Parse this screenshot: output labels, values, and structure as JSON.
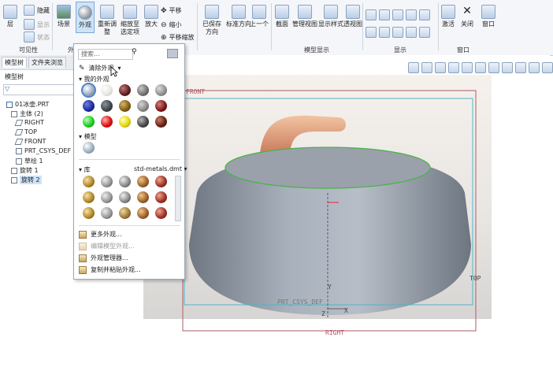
{
  "ribbon": {
    "hide": "隐藏",
    "show": "显示",
    "status": "状态",
    "layer": "层",
    "visibility_group": "可见性",
    "scene": "场景",
    "appearance": "外观",
    "appearance_group": "外观",
    "regenerate": "重新调整",
    "zoom_to_selected": "缩放至选定项",
    "zoom_in": "放大",
    "pan": "平移",
    "zoom_out": "缩小",
    "pan_zoom": "平移缩放",
    "saved_orientations": "已保存方向",
    "standard_orientation": "标准方向",
    "previous": "上一个",
    "section": "截面",
    "manage_views": "管理视图",
    "display_style": "显示样式",
    "perspective": "透视图",
    "model_display_group": "模型显示",
    "show_group": "显示",
    "activate": "激活",
    "close": "关闭",
    "window": "窗口",
    "window_group": "窗口"
  },
  "left_panel": {
    "tab_model_tree": "模型树",
    "tab_file_browser": "文件夹浏览",
    "tree_title": "模型树",
    "items": [
      "01冰壶.PRT",
      "主体 (2)",
      "RIGHT",
      "TOP",
      "FRONT",
      "PRT_CSYS_DEF",
      "草绘 1",
      "旋转 1",
      "旋转 2"
    ]
  },
  "popup": {
    "search_placeholder": "搜索...",
    "clear_appearance": "清除外观",
    "my_appearances": "我的外观",
    "model": "模型",
    "library": "库",
    "library_file": "std-metals.dmt",
    "menu": [
      "更多外观...",
      "编辑模型外观...",
      "外观管理器...",
      "复制并粘贴外观..."
    ]
  },
  "viewport": {
    "front": "FRONT",
    "top": "TOP",
    "right": "RIGHT",
    "csys": "PRT_CSYS_DEF",
    "axis_x": "X",
    "axis_y": "Y",
    "axis_z": "Z"
  },
  "colors": {
    "accent": "#1f5fa8",
    "selection": "#cde3f7",
    "datum_green": "#4ab24a",
    "datum_red": "#b05a63"
  }
}
